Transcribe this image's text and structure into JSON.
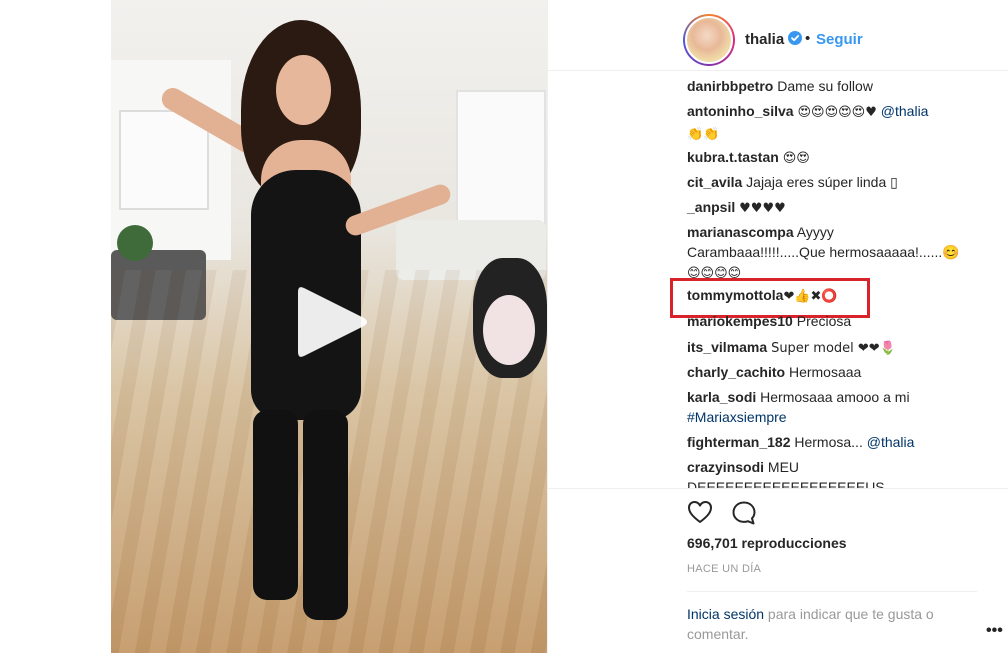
{
  "post": {
    "username": "thalia",
    "follow_label": "Seguir",
    "separator": "•"
  },
  "comments": [
    {
      "user": "danirbbpetro",
      "text": "Dame su follow"
    },
    {
      "user": "antoninho_silva",
      "text": "😍😍😍😍😍♥",
      "mention": "@thalia",
      "text2": "👏👏"
    },
    {
      "user": "kubra.t.tastan",
      "text": "😍😍"
    },
    {
      "user": "cit_avila",
      "text": "Jajaja eres súper linda ▯"
    },
    {
      "user": "_anpsil",
      "text": "♥♥♥♥"
    },
    {
      "user": "marianascompa",
      "text": "Ayyyy",
      "text2": "Carambaaa!!!!!.....Que hermosaaaaa!......😊",
      "text3": "😊😊😊😊"
    },
    {
      "user": "tommymottola",
      "text": "❤👍✖⭕"
    },
    {
      "user": "mariokempes10",
      "text": "Preciosa"
    },
    {
      "user": "its_vilmama",
      "text": "Super model ❤❤🌷"
    },
    {
      "user": "charly_cachito",
      "text": "Hermosaaa"
    },
    {
      "user": "karla_sodi",
      "text": "Hermosaaa amooo a mi",
      "tag": "#Mariaxsiempre"
    },
    {
      "user": "fighterman_182",
      "text": "Hermosa...",
      "mention": "@thalia"
    },
    {
      "user": "crazyinsodi",
      "text": "MEU DEEEEEEEEEEEEEEEEEEUS"
    }
  ],
  "stats": {
    "views": "696,701 reproducciones",
    "time": "HACE UN DÍA"
  },
  "login": {
    "link": "Inicia sesión",
    "text": " para indicar que te gusta o comentar."
  },
  "more_label": "•••",
  "colors": {
    "link": "#3897f0",
    "highlight": "#d9232a",
    "verified": "#3897f0"
  },
  "icons": [
    "play-icon",
    "verified-badge-icon",
    "heart-icon",
    "comment-bubble-icon",
    "more-options-icon"
  ]
}
